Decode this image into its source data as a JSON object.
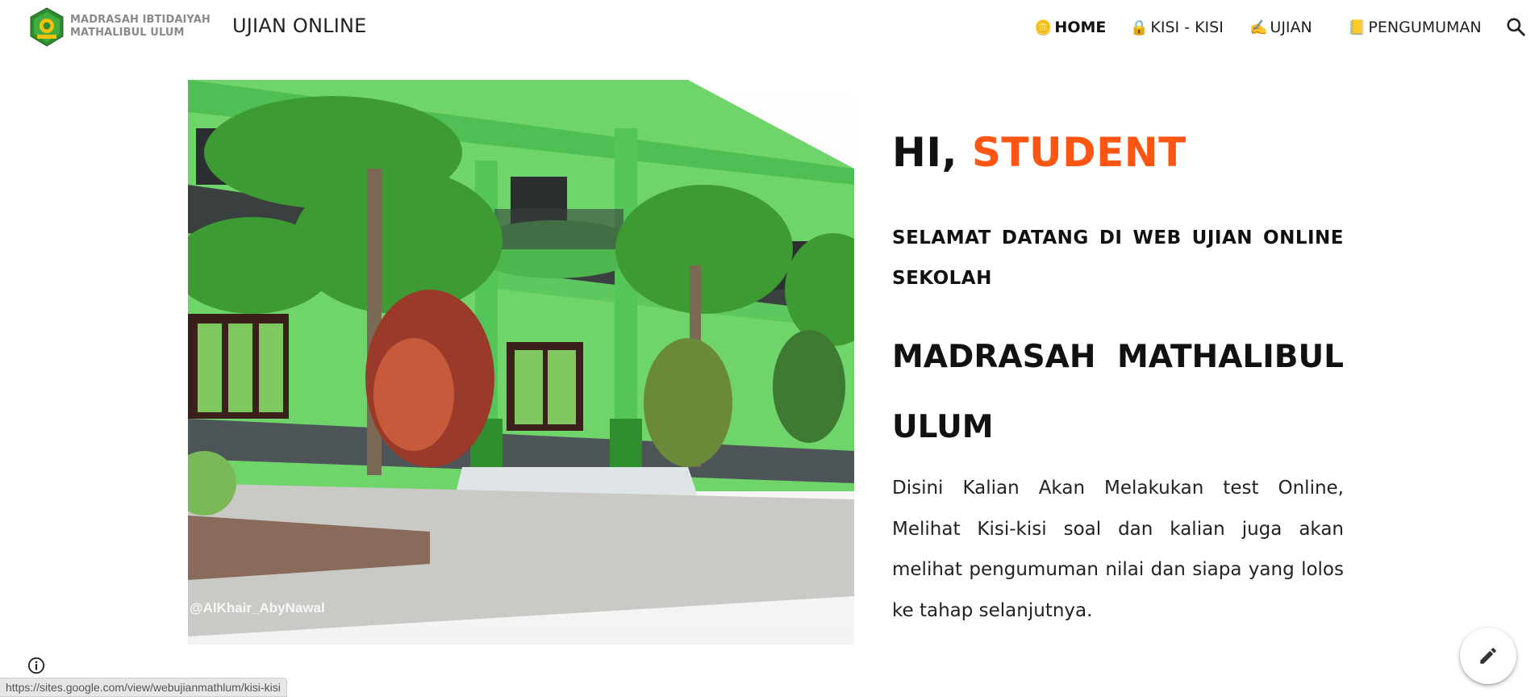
{
  "header": {
    "site_name_line1": "MADRASAH IBTIDAIYAH",
    "site_name_line2": "MATHALIBUL ULUM",
    "site_title": "UJIAN ONLINE",
    "nav": [
      {
        "emoji": "🪙",
        "label": "HOME",
        "active": true
      },
      {
        "emoji": "🔒",
        "label": "KISI - KISI",
        "active": false
      },
      {
        "emoji": "✍️",
        "label": "UJIAN",
        "active": false
      },
      {
        "emoji": "📒",
        "label": "PENGUMUMAN",
        "active": false
      }
    ],
    "search_icon": "search-icon"
  },
  "hero": {
    "greeting_prefix": "HI,",
    "greeting_accent": "STUDENT",
    "accent_color": "#ff5512",
    "welcome": "SELAMAT DATANG DI WEB UJIAN ONLINE SEKOLAH",
    "school_name": "MADRASAH MATHALIBUL ULUM",
    "description": "Disini Kalian Akan Melakukan test Online, Melihat Kisi-kisi soal dan kalian juga akan melihat pengumuman nilai dan siapa yang lolos ke tahap selanjutnya.",
    "image_watermark": "@AlKhair_AbyNawal"
  },
  "footer": {
    "status_url": "https://sites.google.com/view/webujianmathlum/kisi-kisi",
    "info_icon": "info-icon",
    "edit_icon": "pencil-icon"
  }
}
